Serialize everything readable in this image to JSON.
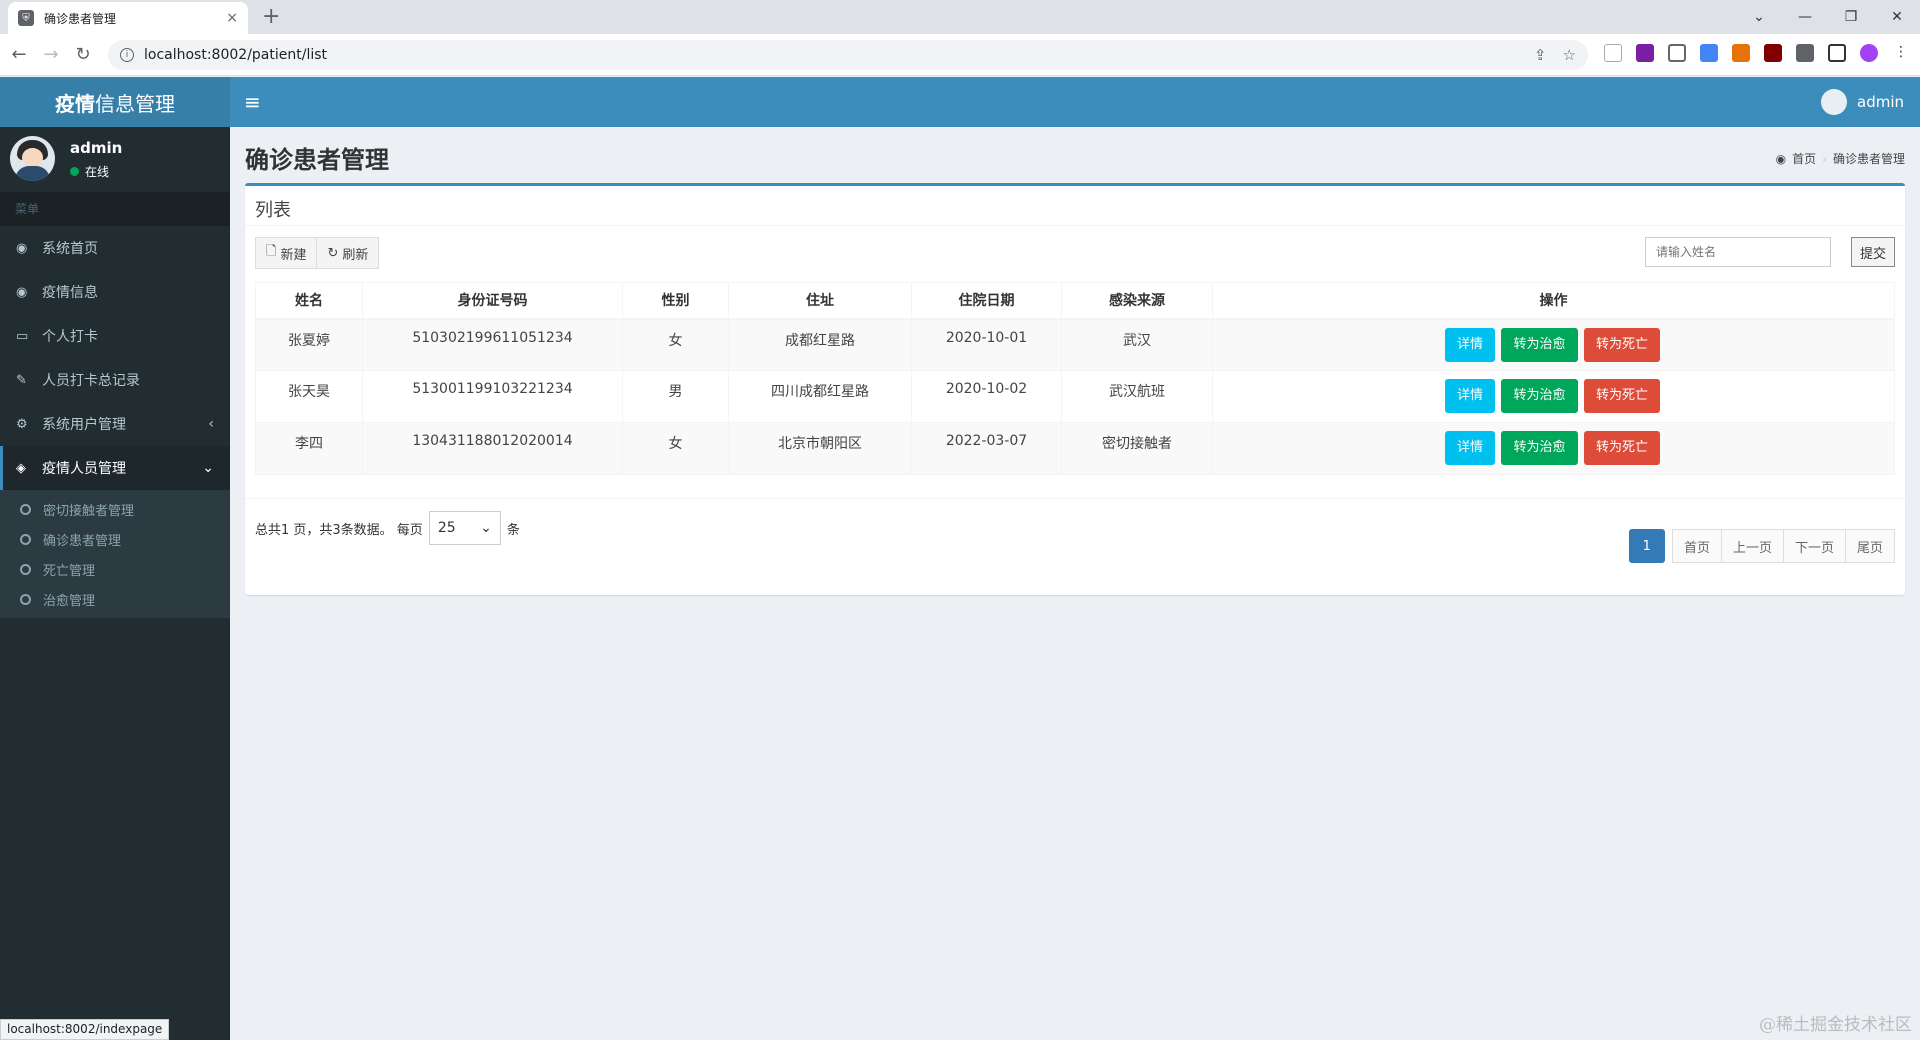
{
  "browser": {
    "tab_title": "确诊患者管理",
    "tab_close": "×",
    "new_tab": "+",
    "url": "localhost:8002/patient/list",
    "status_url": "localhost:8002/indexpage"
  },
  "app": {
    "logo_bold": "疫情",
    "logo_rest": "信息管理",
    "header_user": "admin"
  },
  "sidebar": {
    "user_name": "admin",
    "user_status": "在线",
    "menu_header": "菜单",
    "items": [
      {
        "label": "系统首页",
        "icon": "dashboard-icon"
      },
      {
        "label": "疫情信息",
        "icon": "dashboard-icon"
      },
      {
        "label": "个人打卡",
        "icon": "laptop-icon"
      },
      {
        "label": "人员打卡总记录",
        "icon": "edit-icon"
      },
      {
        "label": "系统用户管理",
        "icon": "cogs-icon"
      },
      {
        "label": "疫情人员管理",
        "icon": "cube-icon"
      }
    ],
    "subitems": [
      "密切接触者管理",
      "确诊患者管理",
      "死亡管理",
      "治愈管理"
    ]
  },
  "content": {
    "title": "确诊患者管理",
    "breadcrumb_home": "首页",
    "breadcrumb_current": "确诊患者管理",
    "box_title": "列表",
    "new_label": "新建",
    "refresh_label": "刷新",
    "search_placeholder": "请输入姓名",
    "submit_label": "提交"
  },
  "table": {
    "headers": [
      "姓名",
      "身份证号码",
      "性别",
      "住址",
      "住院日期",
      "感染来源",
      "操作"
    ],
    "rows": [
      {
        "name": "张夏婷",
        "id": "510302199611051234",
        "gender": "女",
        "address": "成都红星路",
        "date": "2020-10-01",
        "source": "武汉"
      },
      {
        "name": "张天昊",
        "id": "513001199103221234",
        "gender": "男",
        "address": "四川成都红星路",
        "date": "2020-10-02",
        "source": "武汉航班"
      },
      {
        "name": "李四",
        "id": "130431188012020014",
        "gender": "女",
        "address": "北京市朝阳区",
        "date": "2022-03-07",
        "source": "密切接触者"
      }
    ],
    "op_detail": "详情",
    "op_cured": "转为治愈",
    "op_dead": "转为死亡"
  },
  "footer": {
    "summary": "总共1 页，共3条数据。 每页",
    "page_size": "25",
    "unit": "条",
    "current_page": "1",
    "first": "首页",
    "prev": "上一页",
    "next": "下一页",
    "last": "尾页"
  },
  "watermark": "@稀土掘金技术社区",
  "colors": {
    "primary": "#3c8dbc",
    "info": "#00c0ef",
    "success": "#00a65a",
    "danger": "#dd4b39",
    "sidebar": "#222d32"
  }
}
